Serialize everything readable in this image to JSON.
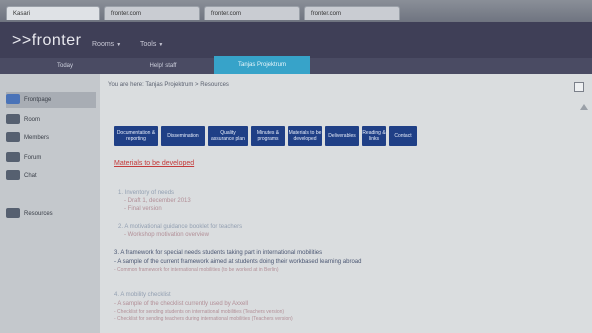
{
  "browser": {
    "tabs": [
      "Kasari",
      "fronter.com",
      "fronter.com",
      "fronter.com"
    ]
  },
  "app": {
    "logo": ">>fronter",
    "menus": [
      "Rooms",
      "Tools"
    ]
  },
  "subnav": {
    "tabs": [
      "Today",
      "Help! staff",
      "Tanjas Projektrum"
    ]
  },
  "sidebar": {
    "items": [
      {
        "label": "Frontpage",
        "icon": "home-icon"
      },
      {
        "label": "Room",
        "icon": "room-icon"
      },
      {
        "label": "Members",
        "icon": "members-icon"
      },
      {
        "label": "Forum",
        "icon": "forum-icon"
      },
      {
        "label": "Chat",
        "icon": "chat-icon"
      },
      {
        "label": "Resources",
        "icon": "folder-icon"
      }
    ]
  },
  "main": {
    "breadcrumb": "You are here: Tanjas Projektrum > Resources",
    "nav_buttons": [
      "Documentation & reporting",
      "Dissemination",
      "Quality assurance plan",
      "Minutes & programs",
      "Materials to be developed",
      "Deliverables",
      "Reading & links",
      "Contact"
    ],
    "section_title": "Materials to be developed",
    "items": [
      {
        "text": "1. Inventory of needs",
        "style": "heading"
      },
      {
        "text": "- Draft 1, december 2013",
        "style": "sub"
      },
      {
        "text": "- Final version",
        "style": "sub"
      },
      {
        "text": "2. A motivational guidance booklet for teachers",
        "style": "heading"
      },
      {
        "text": "- Workshop motivation overview",
        "style": "sub"
      },
      {
        "text": "3. A framework for special needs students taking part in international mobilities",
        "style": "dark"
      },
      {
        "text": "- A sample of the current framework aimed at students doing their workbased learning abroad",
        "style": "dark"
      },
      {
        "text": "- Common framework for international mobilities (to be worked at in Berlin)",
        "style": "sub"
      },
      {
        "text": "4. A mobility checklist",
        "style": "heading"
      },
      {
        "text": "- A sample of the checklist currently used by Axxell",
        "style": "sub"
      },
      {
        "text": "- Checklist for sending students on international mobilities (Teachers version)",
        "style": "sub"
      },
      {
        "text": "- Checklist for sending teachers during international mobilities (Teachers version)",
        "style": "sub"
      }
    ]
  },
  "colors": {
    "topbar": "#3f3f57",
    "active_tab": "#37a3c9",
    "nav_button": "#1f3f86",
    "section_title": "#c43b3b"
  }
}
